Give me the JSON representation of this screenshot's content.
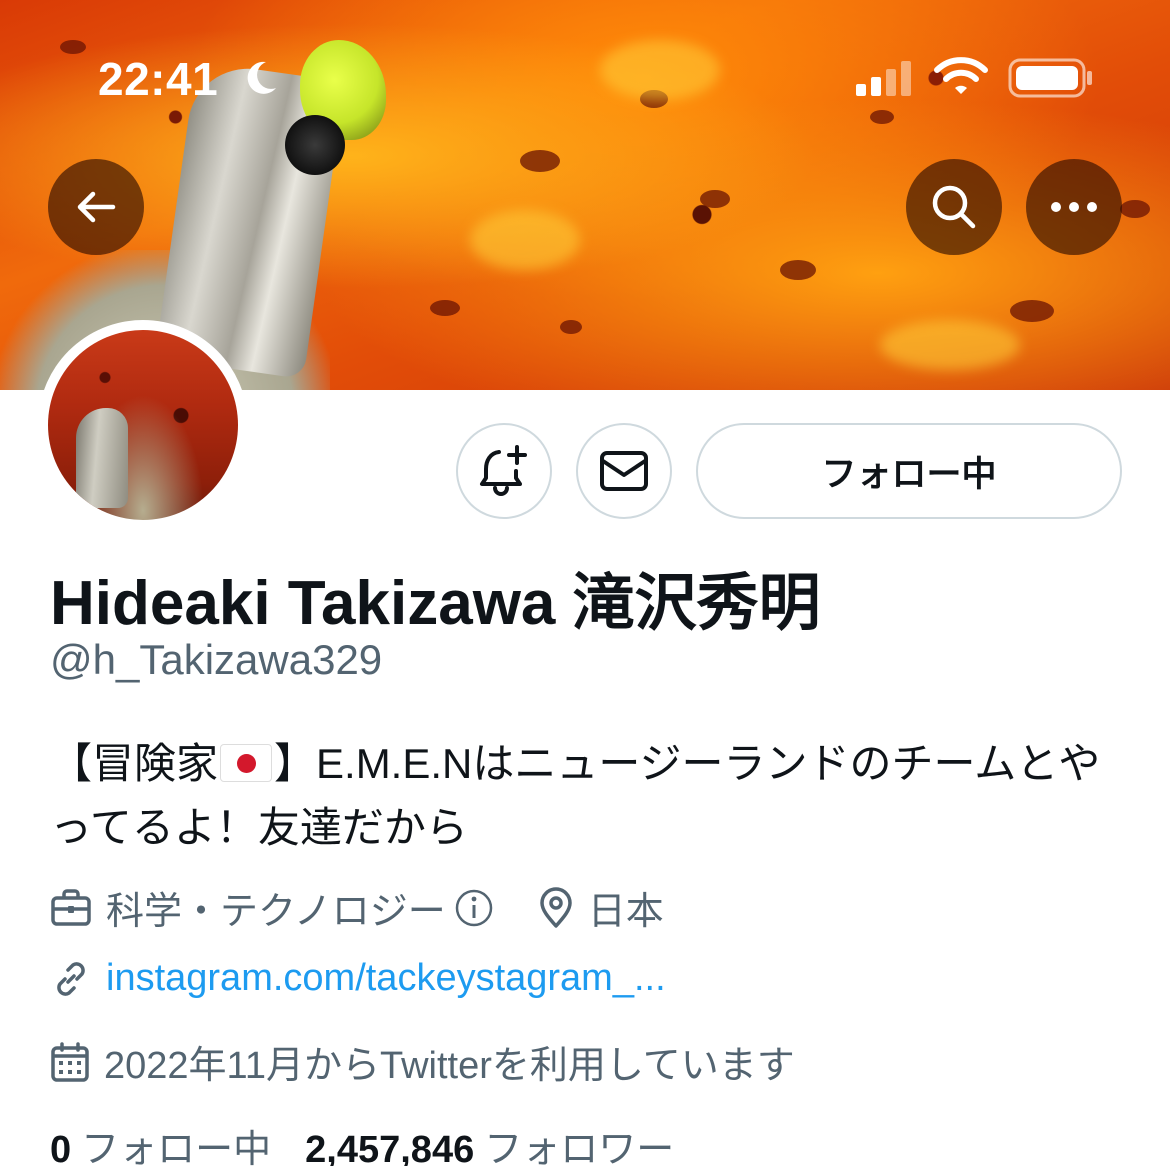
{
  "status_bar": {
    "time": "22:41"
  },
  "header": {
    "back_icon": "arrow-left-icon",
    "search_icon": "search-icon",
    "more_icon": "more-horizontal-icon"
  },
  "actions": {
    "notify_icon": "bell-plus-icon",
    "message_icon": "mail-icon",
    "following_label": "フォロー中"
  },
  "profile": {
    "display_name": "Hideaki Takizawa 滝沢秀明",
    "handle": "@h_Takizawa329",
    "bio_part1": "【冒険家",
    "bio_part2": "】E.M.E.Nはニュージーランドのチームとやってるよ！友達だから",
    "category": "科学・テクノロジー",
    "location": "日本",
    "link": "instagram.com/tackeystagram_...",
    "joined": "2022年11月からTwitterを利用しています"
  },
  "stats": {
    "following_count": "0",
    "following_label": "フォロー中",
    "followers_count": "2,457,846",
    "followers_label": "フォロワー"
  },
  "colors": {
    "accent": "#1d9bf0",
    "secondary_text": "#536471",
    "border": "#cfd9de"
  }
}
